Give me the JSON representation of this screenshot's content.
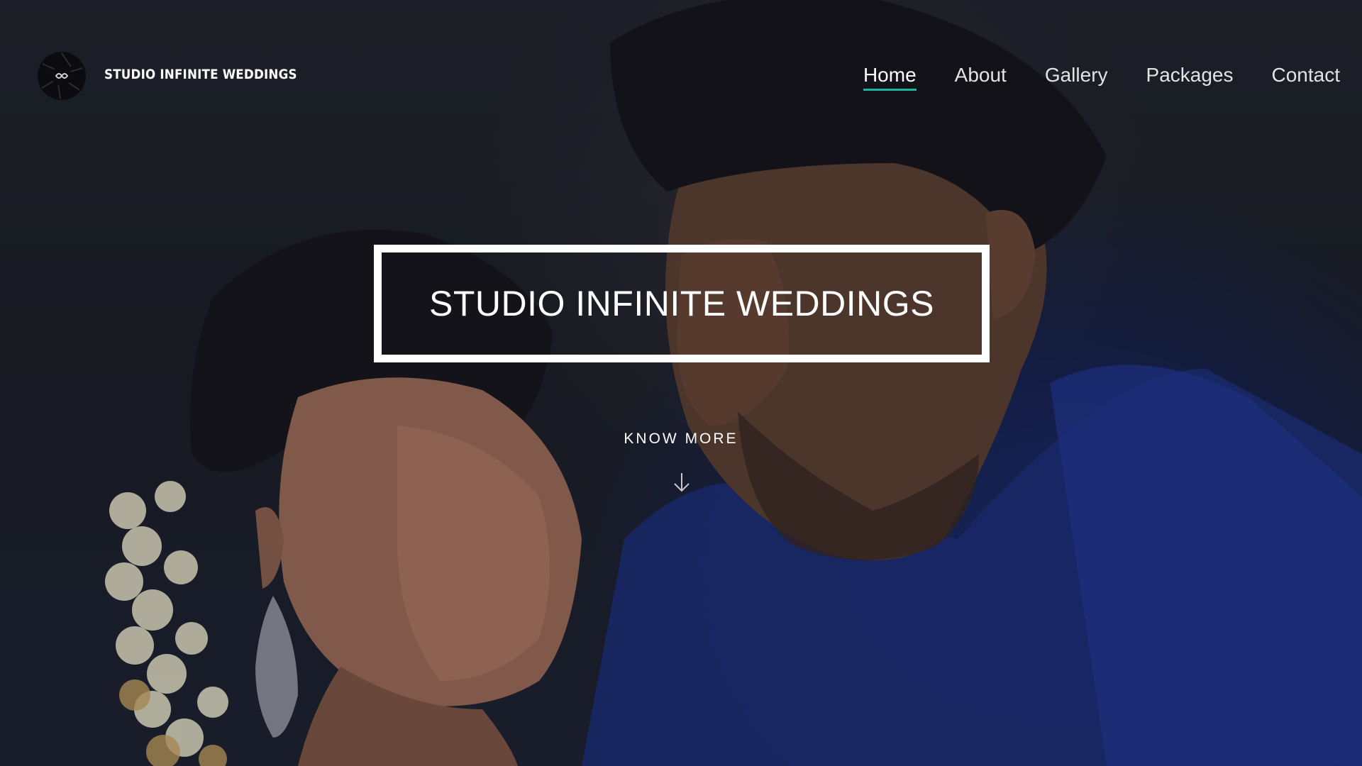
{
  "header": {
    "brand": "STUDIO INFINITE WEDDINGS",
    "logo_icon": "infinity-aperture-logo-icon",
    "nav": [
      {
        "label": "Home",
        "active": true
      },
      {
        "label": "About",
        "active": false
      },
      {
        "label": "Gallery",
        "active": false
      },
      {
        "label": "Packages",
        "active": false
      },
      {
        "label": "Contact",
        "active": false
      }
    ],
    "active_underline_color": "#19b5a0"
  },
  "hero": {
    "title": "STUDIO INFINITE WEDDINGS",
    "cta_label": "KNOW MORE",
    "cta_icon": "arrow-down-icon",
    "background_image": "couple-portrait-photo"
  }
}
